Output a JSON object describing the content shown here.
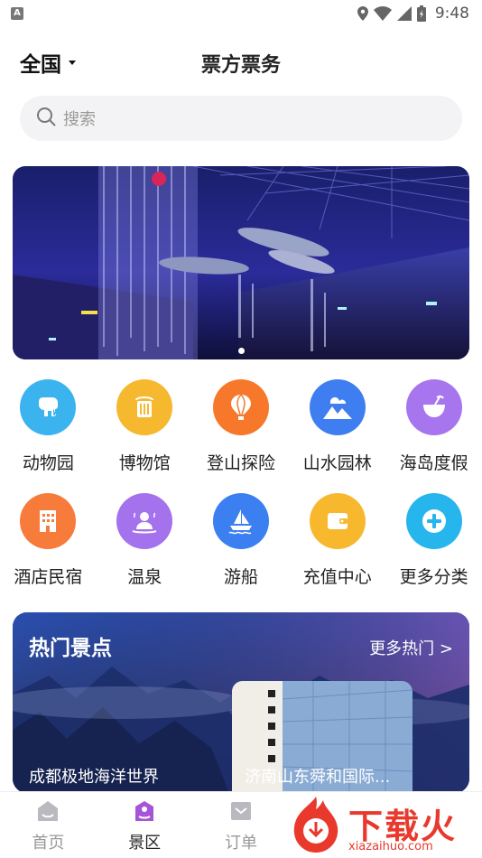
{
  "status_bar": {
    "time": "9:48",
    "notification_icon": "a-icon"
  },
  "header": {
    "region": "全国",
    "title": "票方票务"
  },
  "search": {
    "placeholder": "搜索"
  },
  "banner": {
    "slide_count": 2,
    "active_slide": 0
  },
  "categories": [
    {
      "label": "动物园",
      "icon": "elephant-icon",
      "color": "#3bb3ef"
    },
    {
      "label": "博物馆",
      "icon": "museum-icon",
      "color": "#f5b82e"
    },
    {
      "label": "登山探险",
      "icon": "balloon-icon",
      "color": "#f7782a"
    },
    {
      "label": "山水园林",
      "icon": "mountain-icon",
      "color": "#3f7ef0"
    },
    {
      "label": "海岛度假",
      "icon": "coconut-icon",
      "color": "#a775ee"
    },
    {
      "label": "酒店民宿",
      "icon": "hotel-icon",
      "color": "#f77b3b"
    },
    {
      "label": "温泉",
      "icon": "hot-spring-icon",
      "color": "#a372ec"
    },
    {
      "label": "游船",
      "icon": "boat-icon",
      "color": "#3b7ff0"
    },
    {
      "label": "充值中心",
      "icon": "wallet-icon",
      "color": "#f7b82e"
    },
    {
      "label": "更多分类",
      "icon": "plus-icon",
      "color": "#27b5ee"
    }
  ],
  "hot": {
    "title": "热门景点",
    "more": "更多热门 >",
    "items": [
      {
        "name": "成都极地海洋世界"
      },
      {
        "name": "济南山东舜和国际..."
      }
    ]
  },
  "nav": [
    {
      "label": "首页",
      "icon": "home-icon",
      "active": false
    },
    {
      "label": "景区",
      "icon": "scenic-icon",
      "active": true
    },
    {
      "label": "订单",
      "icon": "order-icon",
      "active": false
    }
  ],
  "watermark": {
    "text": "下载火",
    "sub": "xiazaihuo.com"
  }
}
